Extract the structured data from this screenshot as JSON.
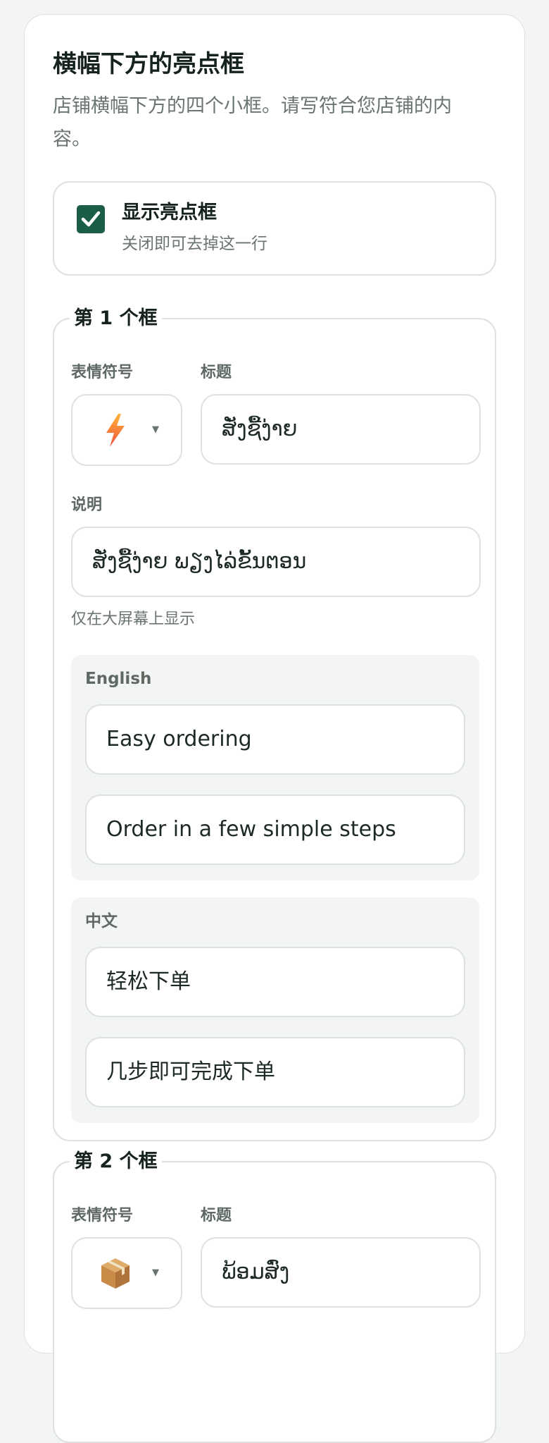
{
  "section": {
    "title": "横幅下方的亮点框",
    "description": "店铺横幅下方的四个小框。请写符合您店铺的内容。"
  },
  "toggle": {
    "label": "显示亮点框",
    "sub_label": "关闭即可去掉这一行",
    "checked": true,
    "accent_color": "#1b5e45"
  },
  "boxes": [
    {
      "legend": "第 1 个框",
      "emoji_label": "表情符号",
      "emoji": "lightning-icon",
      "title_label": "标题",
      "title_value": "ສັ່ງຊື້ງ່າຍ",
      "desc_label": "说明",
      "desc_value": "ສັ່ງຊື້ງ່າຍ ພຽງໄລ່ຂັ້ນຕອນ",
      "desc_hint": "仅在大屏幕上显示",
      "translations": [
        {
          "language": "English",
          "title": "Easy ordering",
          "description": "Order in a few simple steps"
        },
        {
          "language": "中文",
          "title": "轻松下单",
          "description": "几步即可完成下单"
        }
      ]
    },
    {
      "legend": "第 2 个框",
      "emoji_label": "表情符号",
      "emoji": "package-icon",
      "title_label": "标题",
      "title_value": "ພ້ອມສົ່ງ"
    }
  ]
}
